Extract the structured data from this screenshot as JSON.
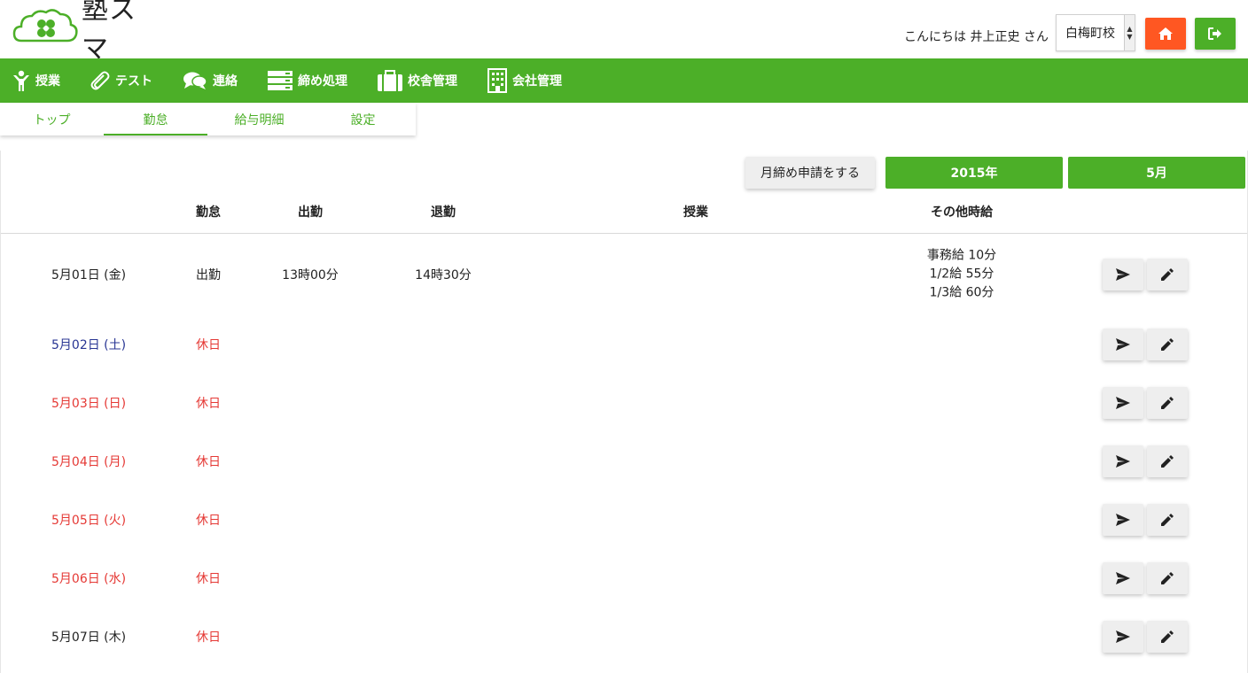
{
  "app": {
    "logo_text": "塾スマ"
  },
  "header": {
    "greeting": "こんにちは 井上正史 さん",
    "school_select": "白梅町校"
  },
  "nav": [
    {
      "label": "授業",
      "icon": "person-icon"
    },
    {
      "label": "テスト",
      "icon": "paperclip-icon"
    },
    {
      "label": "連絡",
      "icon": "chat-icon"
    },
    {
      "label": "締め処理",
      "icon": "server-icon"
    },
    {
      "label": "校舎管理",
      "icon": "briefcase-icon"
    },
    {
      "label": "会社管理",
      "icon": "building-icon"
    }
  ],
  "subtabs": [
    {
      "label": "トップ"
    },
    {
      "label": "勤怠",
      "active": true
    },
    {
      "label": "給与明細"
    },
    {
      "label": "設定"
    }
  ],
  "toolbar": {
    "close_month": "月締め申請をする",
    "year": "2015年",
    "month": "5月"
  },
  "columns": {
    "status": "勤怠",
    "start": "出勤",
    "end": "退勤",
    "lesson": "授業",
    "other_pay": "その他時給"
  },
  "colors": {
    "green": "#4caf28",
    "orange": "#ff5722",
    "saturday_blue": "#283593",
    "holiday_red": "#e53935"
  },
  "rows": [
    {
      "date": "5月01日 (金)",
      "status": "出勤",
      "start": "13時00分",
      "end": "14時30分",
      "other": [
        "事務給 10分",
        "1/2給 55分",
        "1/3給 60分"
      ],
      "date_color": "black",
      "status_color": "black"
    },
    {
      "date": "5月02日 (土)",
      "status": "休日",
      "start": "",
      "end": "",
      "other": [],
      "date_color": "blue",
      "status_color": "red"
    },
    {
      "date": "5月03日 (日)",
      "status": "休日",
      "start": "",
      "end": "",
      "other": [],
      "date_color": "red",
      "status_color": "red"
    },
    {
      "date": "5月04日 (月)",
      "status": "休日",
      "start": "",
      "end": "",
      "other": [],
      "date_color": "red",
      "status_color": "red"
    },
    {
      "date": "5月05日 (火)",
      "status": "休日",
      "start": "",
      "end": "",
      "other": [],
      "date_color": "red",
      "status_color": "red"
    },
    {
      "date": "5月06日 (水)",
      "status": "休日",
      "start": "",
      "end": "",
      "other": [],
      "date_color": "red",
      "status_color": "red"
    },
    {
      "date": "5月07日 (木)",
      "status": "休日",
      "start": "",
      "end": "",
      "other": [],
      "date_color": "black",
      "status_color": "red"
    }
  ]
}
